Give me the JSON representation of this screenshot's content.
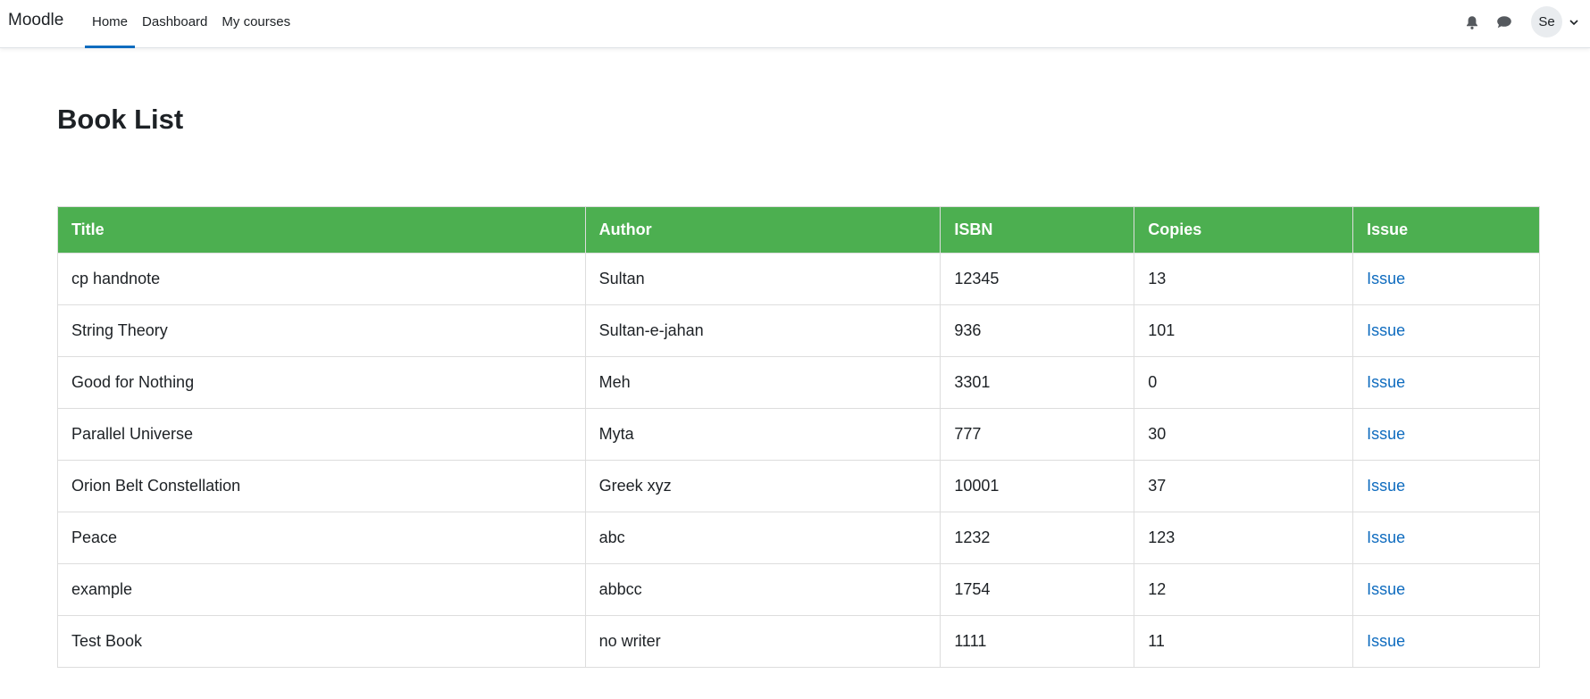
{
  "navbar": {
    "brand": "Moodle",
    "links": [
      {
        "label": "Home",
        "active": true
      },
      {
        "label": "Dashboard",
        "active": false
      },
      {
        "label": "My courses",
        "active": false
      }
    ],
    "icons": [
      "bell-icon",
      "chat-icon"
    ],
    "avatar_initials": "Se"
  },
  "page": {
    "title": "Book List"
  },
  "table": {
    "header_color": "#4caf50",
    "link_color": "#0f6cbf",
    "columns": [
      "Title",
      "Author",
      "ISBN",
      "Copies",
      "Issue"
    ],
    "rows": [
      {
        "title": "cp handnote",
        "author": "Sultan",
        "isbn": "12345",
        "copies": "13",
        "issue": "Issue"
      },
      {
        "title": "String Theory",
        "author": "Sultan-e-jahan",
        "isbn": "936",
        "copies": "101",
        "issue": "Issue"
      },
      {
        "title": "Good for Nothing",
        "author": "Meh",
        "isbn": "3301",
        "copies": "0",
        "issue": "Issue"
      },
      {
        "title": "Parallel Universe",
        "author": "Myta",
        "isbn": "777",
        "copies": "30",
        "issue": "Issue"
      },
      {
        "title": "Orion Belt Constellation",
        "author": "Greek xyz",
        "isbn": "10001",
        "copies": "37",
        "issue": "Issue"
      },
      {
        "title": "Peace",
        "author": "abc",
        "isbn": "1232",
        "copies": "123",
        "issue": "Issue"
      },
      {
        "title": "example",
        "author": "abbcc",
        "isbn": "1754",
        "copies": "12",
        "issue": "Issue"
      },
      {
        "title": "Test Book",
        "author": "no writer",
        "isbn": "1111",
        "copies": "11",
        "issue": "Issue"
      }
    ]
  }
}
